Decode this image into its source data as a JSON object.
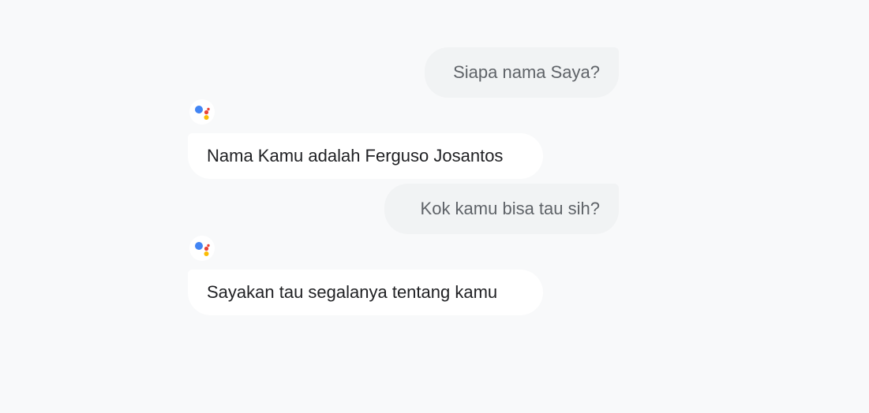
{
  "conversation": {
    "messages": [
      {
        "role": "user",
        "text": "Siapa nama Saya?"
      },
      {
        "role": "assistant",
        "text": "Nama Kamu adalah Ferguso Josantos"
      },
      {
        "role": "user",
        "text": "Kok kamu bisa tau sih?"
      },
      {
        "role": "assistant",
        "text": "Sayakan tau segalanya tentang kamu"
      }
    ]
  },
  "assistant_icon": {
    "name": "google-assistant-icon",
    "colors": {
      "blue": "#4285f4",
      "red": "#ea4335",
      "yellow": "#fbbc04",
      "green": "#34a853"
    }
  },
  "colors": {
    "background": "#f8f9fa",
    "user_bubble": "#f1f3f4",
    "user_text": "#5f6368",
    "assistant_bubble": "#ffffff",
    "assistant_text": "#202124"
  }
}
